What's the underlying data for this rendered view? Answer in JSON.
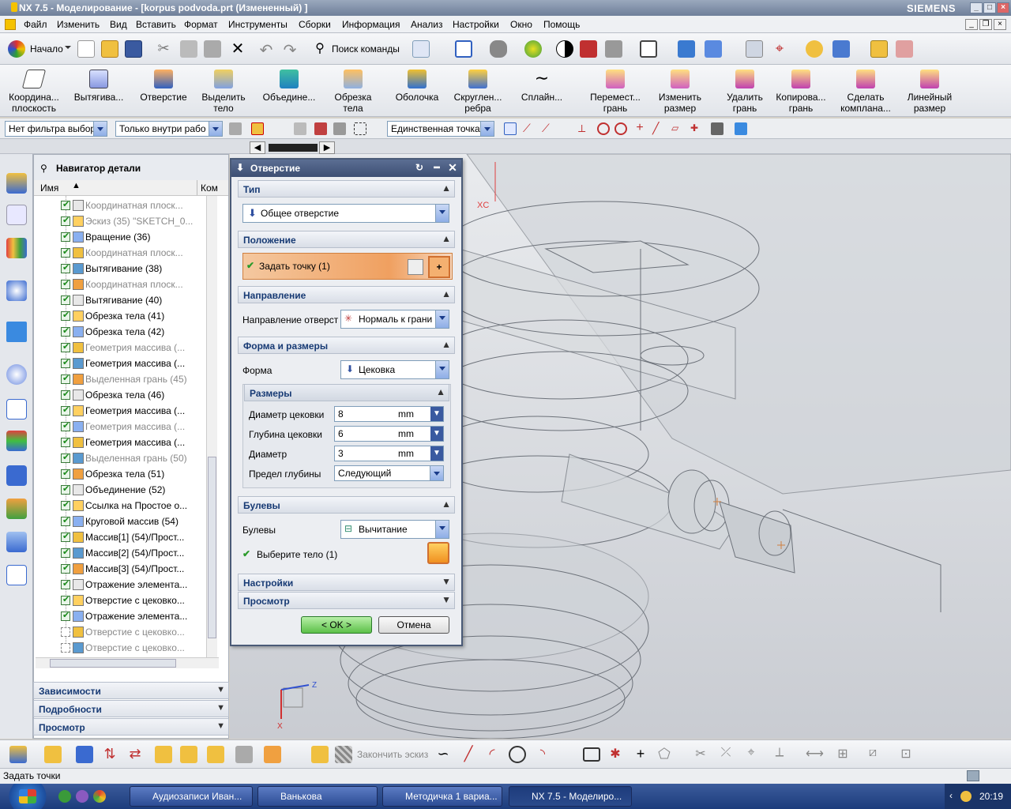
{
  "window": {
    "title": "NX 7.5 - Моделирование - [korpus podvoda.prt (Измененный) ]",
    "brand": "SIEMENS"
  },
  "menu": [
    "Файл",
    "Изменить",
    "Вид",
    "Вставить",
    "Формат",
    "Инструменты",
    "Сборки",
    "Информация",
    "Анализ",
    "Настройки",
    "Окно",
    "Помощь"
  ],
  "toolbar1": {
    "start_label": "Начало",
    "search_label": "Поиск команды"
  },
  "toolbar2": [
    {
      "label": "Координа... плоскость",
      "icon": "datum-plane-icon"
    },
    {
      "label": "Вытягива...",
      "icon": "extrude-icon"
    },
    {
      "label": "Отверстие",
      "icon": "hole-icon"
    },
    {
      "label": "Выделить тело",
      "icon": "extract-body-icon"
    },
    {
      "label": "Объедине...",
      "icon": "unite-icon"
    },
    {
      "label": "Обрезка тела",
      "icon": "trim-body-icon"
    },
    {
      "label": "Оболочка",
      "icon": "shell-icon"
    },
    {
      "label": "Скруглен... ребра",
      "icon": "edge-blend-icon"
    },
    {
      "label": "Сплайн...",
      "icon": "spline-icon"
    },
    {
      "label": "Перемест... грань",
      "icon": "move-face-icon"
    },
    {
      "label": "Изменить размер",
      "icon": "resize-icon"
    },
    {
      "label": "Удалить грань",
      "icon": "delete-face-icon"
    },
    {
      "label": "Копирова... грань",
      "icon": "copy-face-icon"
    },
    {
      "label": "Сделать компланa...",
      "icon": "coplanar-icon"
    },
    {
      "label": "Линейный размер",
      "icon": "linear-dimension-icon"
    }
  ],
  "filters": {
    "type_filter": "Нет фильтра выбор",
    "scope_filter": "Только внутри рабо",
    "snap_filter": "Единственная точка"
  },
  "navigator": {
    "title": "Навигатор детали",
    "col_name": "Имя",
    "col_comment": "Ком",
    "items": [
      {
        "label": "Координатная плоск...",
        "dim": true,
        "checked": true
      },
      {
        "label": "Эскиз (35) \"SKETCH_0...",
        "dim": true,
        "checked": true
      },
      {
        "label": "Вращение (36)",
        "dim": false,
        "checked": true
      },
      {
        "label": "Координатная плоск...",
        "dim": true,
        "checked": true
      },
      {
        "label": "Вытягивание (38)",
        "dim": false,
        "checked": true
      },
      {
        "label": "Координатная плоск...",
        "dim": true,
        "checked": true
      },
      {
        "label": "Вытягивание (40)",
        "dim": false,
        "checked": true
      },
      {
        "label": "Обрезка тела (41)",
        "dim": false,
        "checked": true
      },
      {
        "label": "Обрезка тела (42)",
        "dim": false,
        "checked": true
      },
      {
        "label": "Геометрия массива (...",
        "dim": true,
        "checked": true
      },
      {
        "label": "Геометрия массива (...",
        "dim": false,
        "checked": true
      },
      {
        "label": "Выделенная грань (45)",
        "dim": true,
        "checked": true
      },
      {
        "label": "Обрезка тела (46)",
        "dim": false,
        "checked": true
      },
      {
        "label": "Геометрия массива (...",
        "dim": false,
        "checked": true
      },
      {
        "label": "Геометрия массива (...",
        "dim": true,
        "checked": true
      },
      {
        "label": "Геометрия массива (...",
        "dim": false,
        "checked": true
      },
      {
        "label": "Выделенная грань (50)",
        "dim": true,
        "checked": true
      },
      {
        "label": "Обрезка тела (51)",
        "dim": false,
        "checked": true
      },
      {
        "label": "Объединение (52)",
        "dim": false,
        "checked": true
      },
      {
        "label": "Ссылка на Простое о...",
        "dim": false,
        "checked": true
      },
      {
        "label": "Круговой массив (54)",
        "dim": false,
        "checked": true
      },
      {
        "label": "Массив[1] (54)/Прост...",
        "dim": false,
        "checked": true
      },
      {
        "label": "Массив[2] (54)/Прост...",
        "dim": false,
        "checked": true
      },
      {
        "label": "Массив[3] (54)/Прост...",
        "dim": false,
        "checked": true
      },
      {
        "label": "Отражение элемента...",
        "dim": false,
        "checked": true
      },
      {
        "label": "Отверстие с цековко...",
        "dim": false,
        "checked": true
      },
      {
        "label": "Отражение элемента...",
        "dim": false,
        "checked": true
      },
      {
        "label": "Отверстие с цековко...",
        "dim": true,
        "checked": false
      },
      {
        "label": "Отверстие с цековко...",
        "dim": true,
        "checked": false
      }
    ],
    "panels": [
      "Зависимости",
      "Подробности",
      "Просмотр"
    ]
  },
  "dialog": {
    "title": "Отверстие",
    "sec_type": "Тип",
    "type_value": "Общее отверстие",
    "sec_position": "Положение",
    "specify_point": "Задать точку (1)",
    "sec_direction": "Направление",
    "direction_label": "Направление отверст",
    "direction_value": "Нормаль к грани",
    "sec_form": "Форма и размеры",
    "form_label": "Форма",
    "form_value": "Цековка",
    "sec_dims": "Размеры",
    "cb_diam_label": "Диаметр цековки",
    "cb_diam_value": "8",
    "cb_depth_label": "Глубина цековки",
    "cb_depth_value": "6",
    "diam_label": "Диаметр",
    "diam_value": "3",
    "unit": "mm",
    "depth_limit_label": "Предел глубины",
    "depth_limit_value": "Следующий",
    "sec_boolean": "Булевы",
    "boolean_label": "Булевы",
    "boolean_value": "Вычитание",
    "select_body": "Выберите тело (1)",
    "sec_settings": "Настройки",
    "sec_preview": "Просмотр",
    "ok": "< OK >",
    "cancel": "Отмена"
  },
  "bottom_toolbar": {
    "finish_sketch": "Закончить эскиз"
  },
  "status": "Задать точки",
  "taskbar": {
    "tasks": [
      "Аудиозаписи Иван...",
      "Ванькова",
      "Методичка 1 вариа...",
      "NX 7.5 - Моделиро..."
    ],
    "clock": "20:19"
  },
  "viewport": {
    "axis_xc": "XC",
    "axis_z": "Z",
    "axis_x": "X"
  },
  "colors": {
    "accent": "#3d4f73",
    "point_highlight": "#f0a060",
    "ok_green": "#2a9a2a"
  }
}
